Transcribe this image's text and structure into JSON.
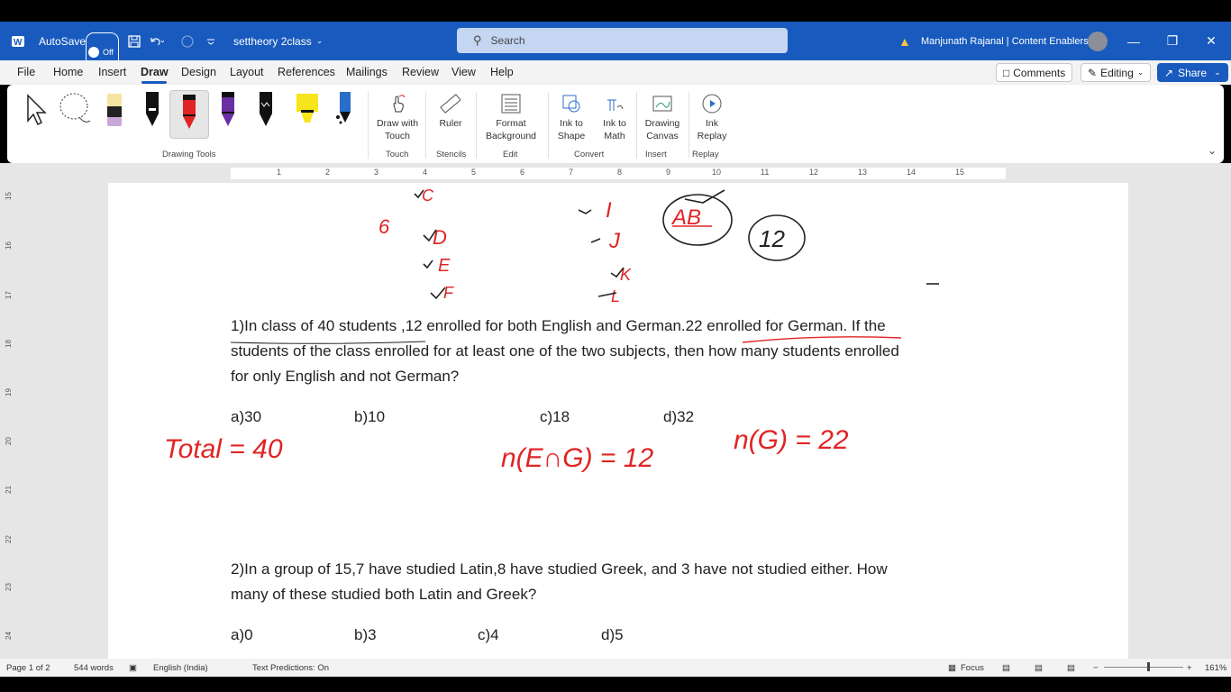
{
  "titlebar": {
    "autosave_label": "AutoSave",
    "autosave_state": "Off",
    "doc_name": "settheory 2class",
    "search_placeholder": "Search",
    "user_name": "Manjunath Rajanal | Content Enablers"
  },
  "menu": {
    "items": [
      "File",
      "Home",
      "Insert",
      "Draw",
      "Design",
      "Layout",
      "References",
      "Mailings",
      "Review",
      "View",
      "Help"
    ],
    "active": "Draw",
    "comments_label": "Comments",
    "editing_label": "Editing",
    "share_label": "Share"
  },
  "ribbon": {
    "group_drawing_tools": "Drawing Tools",
    "draw_with_touch": "Draw with Touch",
    "ruler": "Ruler",
    "format_background": "Format Background",
    "ink_to_shape": "Ink to Shape",
    "ink_to_math": "Ink to Math",
    "drawing_canvas": "Drawing Canvas",
    "ink_replay": "Ink Replay",
    "group_touch": "Touch",
    "group_stencils": "Stencils",
    "group_edit": "Edit",
    "group_convert": "Convert",
    "group_insert": "Insert",
    "group_replay": "Replay"
  },
  "ruler": {
    "h": [
      "1",
      "2",
      "3",
      "4",
      "5",
      "6",
      "7",
      "8",
      "9",
      "10",
      "11",
      "12",
      "13",
      "14",
      "15"
    ],
    "v": [
      "15",
      "16",
      "17",
      "18",
      "19",
      "20",
      "21",
      "22",
      "23",
      "24"
    ]
  },
  "document": {
    "q1_line1": "1)In class of 40 students ,12 enrolled for both English and German.22 enrolled for German. If the",
    "q1_line2": "students of the class enrolled for at least one of the two subjects, then how many students enrolled",
    "q1_line3": "for only English and not German?",
    "q1_options": [
      "a)30",
      "b)10",
      "c)18",
      "d)32"
    ],
    "q2_line1": "2)In a group of 15,7 have studied Latin,8 have studied Greek, and 3 have not studied either. How",
    "q2_line2": "many of these studied both Latin and Greek?",
    "q2_options": [
      "a)0",
      "b)3",
      "c)4",
      "d)5"
    ],
    "ink_text": {
      "six": "6",
      "letters_left": [
        "C",
        "D",
        "E",
        "F"
      ],
      "letters_right": [
        "I",
        "J",
        "K",
        "L"
      ],
      "ab": "AB",
      "twelve": "12",
      "total": "Total = 40",
      "n_inter": "n(E∩G) = 12",
      "n_g": "n(G) = 22"
    },
    "ink_color": "#e02424"
  },
  "status": {
    "page": "Page 1 of 2",
    "words": "544 words",
    "language": "English (India)",
    "predictions": "Text Predictions: On",
    "focus": "Focus",
    "zoom": "161%"
  },
  "colors": {
    "titlebar": "#185abd",
    "accent": "#185abd"
  }
}
